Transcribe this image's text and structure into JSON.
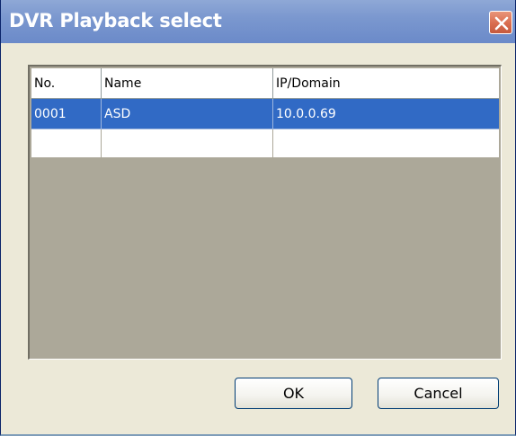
{
  "window": {
    "title": "DVR Playback select",
    "close_icon": "close-icon"
  },
  "table": {
    "columns": [
      "No.",
      "Name",
      "IP/Domain"
    ],
    "rows": [
      {
        "no": "0001",
        "name": "ASD",
        "ip": "10.0.0.69",
        "selected": true
      },
      {
        "no": "",
        "name": "",
        "ip": "",
        "selected": false
      }
    ]
  },
  "buttons": {
    "ok_label": "OK",
    "cancel_label": "Cancel"
  },
  "colors": {
    "selection": "#316ac5",
    "title_bar": "#7b98cf",
    "dialog_face": "#ece9d8",
    "grid_background": "#aca899",
    "close_button": "#d96d4f"
  }
}
